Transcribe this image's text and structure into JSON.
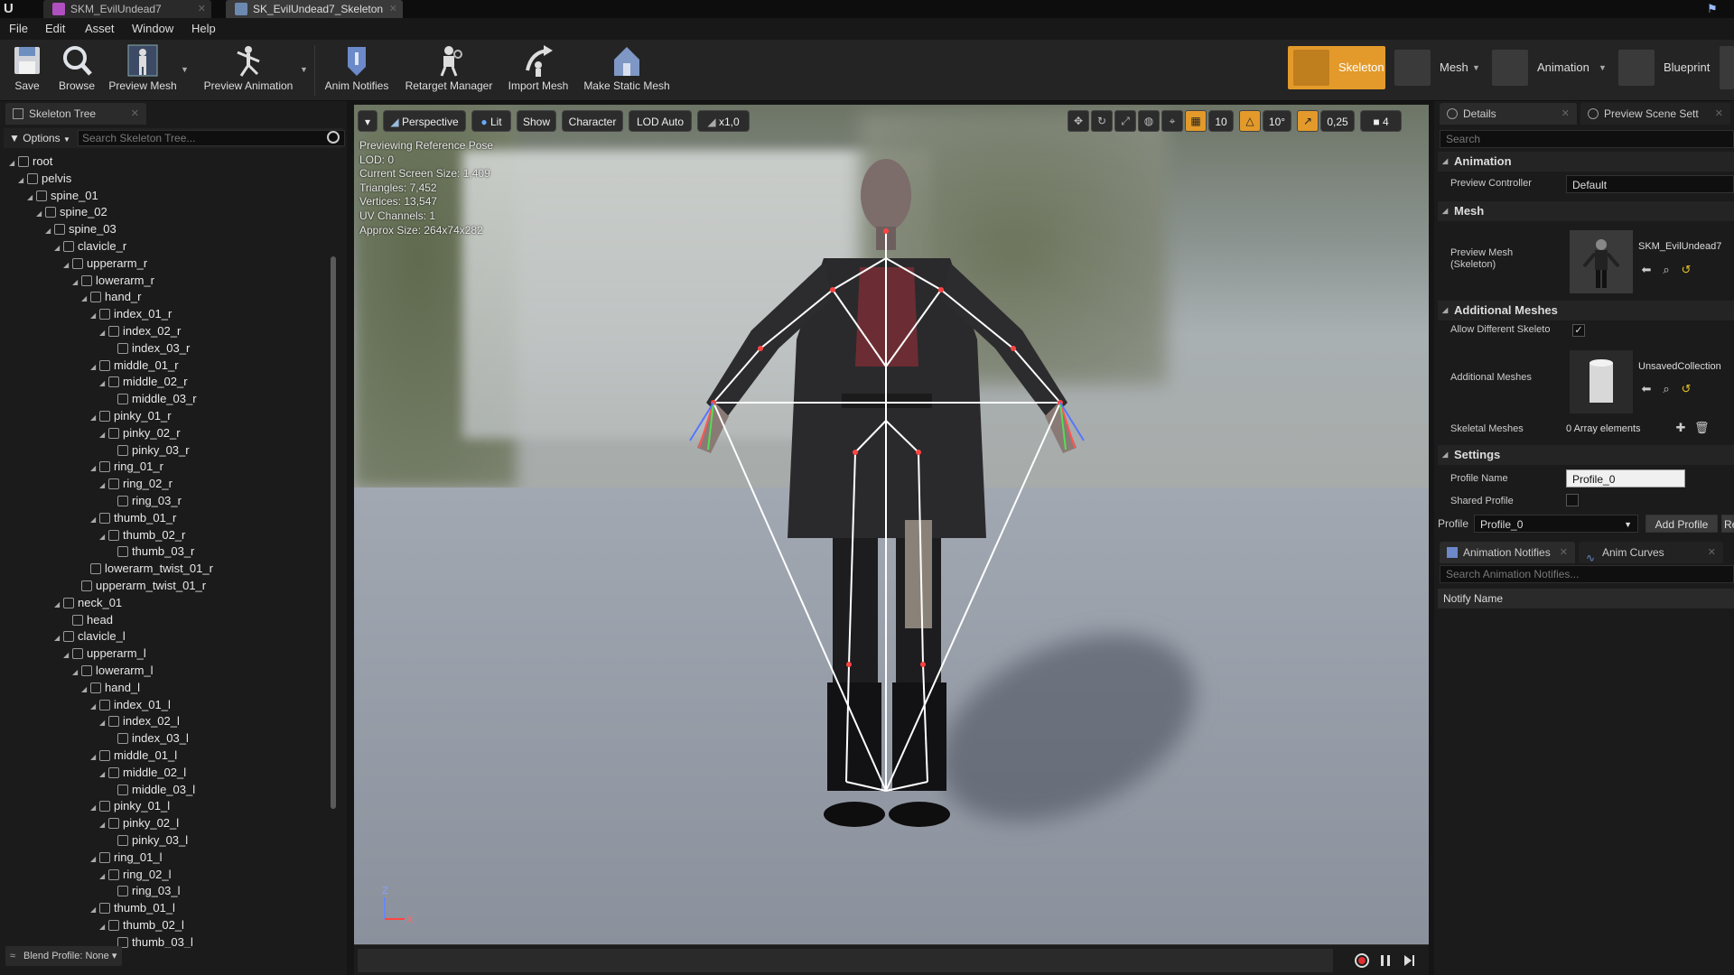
{
  "titlebar": {
    "tabs": [
      "SKM_EvilUndead7",
      "SK_EvilUndead7_Skeleton"
    ]
  },
  "menu": [
    "File",
    "Edit",
    "Asset",
    "Window",
    "Help"
  ],
  "toolbar": {
    "save": "Save",
    "browse": "Browse",
    "preview_mesh": "Preview Mesh",
    "preview_animation": "Preview Animation",
    "anim_notifies": "Anim Notifies",
    "retarget_manager": "Retarget Manager",
    "import_mesh": "Import Mesh",
    "make_static_mesh": "Make Static Mesh"
  },
  "modes": [
    "Skeleton",
    "Mesh",
    "Animation",
    "Blueprint"
  ],
  "skeleton_tree": {
    "tab_label": "Skeleton Tree",
    "options_label": "Options",
    "search_placeholder": "Search Skeleton Tree...",
    "blend_profile": "Blend Profile: None",
    "bones": [
      {
        "name": "root",
        "depth": 0
      },
      {
        "name": "pelvis",
        "depth": 1
      },
      {
        "name": "spine_01",
        "depth": 2
      },
      {
        "name": "spine_02",
        "depth": 3
      },
      {
        "name": "spine_03",
        "depth": 4
      },
      {
        "name": "clavicle_r",
        "depth": 5
      },
      {
        "name": "upperarm_r",
        "depth": 6
      },
      {
        "name": "lowerarm_r",
        "depth": 7
      },
      {
        "name": "hand_r",
        "depth": 8
      },
      {
        "name": "index_01_r",
        "depth": 9
      },
      {
        "name": "index_02_r",
        "depth": 10
      },
      {
        "name": "index_03_r",
        "depth": 11
      },
      {
        "name": "middle_01_r",
        "depth": 9
      },
      {
        "name": "middle_02_r",
        "depth": 10
      },
      {
        "name": "middle_03_r",
        "depth": 11
      },
      {
        "name": "pinky_01_r",
        "depth": 9
      },
      {
        "name": "pinky_02_r",
        "depth": 10
      },
      {
        "name": "pinky_03_r",
        "depth": 11
      },
      {
        "name": "ring_01_r",
        "depth": 9
      },
      {
        "name": "ring_02_r",
        "depth": 10
      },
      {
        "name": "ring_03_r",
        "depth": 11
      },
      {
        "name": "thumb_01_r",
        "depth": 9
      },
      {
        "name": "thumb_02_r",
        "depth": 10
      },
      {
        "name": "thumb_03_r",
        "depth": 11
      },
      {
        "name": "lowerarm_twist_01_r",
        "depth": 8
      },
      {
        "name": "upperarm_twist_01_r",
        "depth": 7
      },
      {
        "name": "neck_01",
        "depth": 5
      },
      {
        "name": "head",
        "depth": 6
      },
      {
        "name": "clavicle_l",
        "depth": 5
      },
      {
        "name": "upperarm_l",
        "depth": 6
      },
      {
        "name": "lowerarm_l",
        "depth": 7
      },
      {
        "name": "hand_l",
        "depth": 8
      },
      {
        "name": "index_01_l",
        "depth": 9
      },
      {
        "name": "index_02_l",
        "depth": 10
      },
      {
        "name": "index_03_l",
        "depth": 11
      },
      {
        "name": "middle_01_l",
        "depth": 9
      },
      {
        "name": "middle_02_l",
        "depth": 10
      },
      {
        "name": "middle_03_l",
        "depth": 11
      },
      {
        "name": "pinky_01_l",
        "depth": 9
      },
      {
        "name": "pinky_02_l",
        "depth": 10
      },
      {
        "name": "pinky_03_l",
        "depth": 11
      },
      {
        "name": "ring_01_l",
        "depth": 9
      },
      {
        "name": "ring_02_l",
        "depth": 10
      },
      {
        "name": "ring_03_l",
        "depth": 11
      },
      {
        "name": "thumb_01_l",
        "depth": 9
      },
      {
        "name": "thumb_02_l",
        "depth": 10
      },
      {
        "name": "thumb_03_l",
        "depth": 11
      }
    ]
  },
  "viewport": {
    "toolbar": {
      "perspective": "Perspective",
      "lit": "Lit",
      "show": "Show",
      "character": "Character",
      "lod": "LOD Auto",
      "speed": "x1,0",
      "grid_snap": "10",
      "rotation_snap": "10°",
      "scale_snap": "0,25",
      "camera_speed": "4"
    },
    "stats": [
      "Previewing Reference Pose",
      "LOD: 0",
      "Current Screen Size: 1,409",
      "Triangles: 7,452",
      "Vertices: 13,547",
      "UV Channels: 1",
      "Approx Size: 264x74x282"
    ]
  },
  "details": {
    "tab_details": "Details",
    "tab_preview_scene": "Preview Scene Sett",
    "search_placeholder": "Search",
    "categories": {
      "animation": "Animation",
      "mesh": "Mesh",
      "additional_meshes": "Additional Meshes",
      "settings": "Settings"
    },
    "preview_controller_label": "Preview Controller",
    "preview_controller_value": "Default",
    "preview_mesh_label": "Preview Mesh (Skeleton)",
    "preview_mesh_value": "SKM_EvilUndead7",
    "allow_different_label": "Allow Different Skeleto",
    "additional_meshes_label": "Additional Meshes",
    "additional_meshes_value": "UnsavedCollection",
    "skeletal_meshes_label": "Skeletal Meshes",
    "skeletal_meshes_value": "0 Array elements",
    "profile_name_label": "Profile Name",
    "profile_name_value": "Profile_0",
    "shared_profile_label": "Shared Profile",
    "profile_label": "Profile",
    "profile_value": "Profile_0",
    "add_profile": "Add Profile",
    "remove_profile": "Re"
  },
  "anim_notifies": {
    "tab_label": "Animation Notifies",
    "curves_tab": "Anim Curves",
    "search_placeholder": "Search Animation Notifies...",
    "column_header": "Notify Name"
  }
}
